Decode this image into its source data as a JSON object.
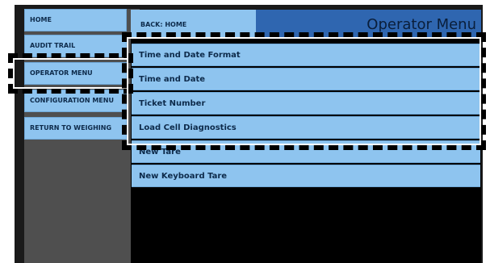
{
  "window": {
    "title": "Operator Menu",
    "back_label": "BACK: HOME"
  },
  "sidebar": {
    "items": [
      {
        "label": "HOME"
      },
      {
        "label": "AUDIT TRAIL"
      },
      {
        "label": "OPERATOR MENU"
      },
      {
        "label": "CONFIGURATION MENU"
      },
      {
        "label": "RETURN TO WEIGHING"
      }
    ]
  },
  "menu": {
    "items": [
      {
        "label": "Time and Date Format"
      },
      {
        "label": "Time and Date"
      },
      {
        "label": "Ticket Number"
      },
      {
        "label": "Load Cell Diagnostics"
      },
      {
        "label": "New Tare"
      },
      {
        "label": "New Keyboard Tare"
      }
    ]
  },
  "colors": {
    "button_fill": "#8ec4ef",
    "title_fill": "#2f66b0",
    "sidebar_fill": "#4f4f4f",
    "main_fill": "#000000"
  }
}
